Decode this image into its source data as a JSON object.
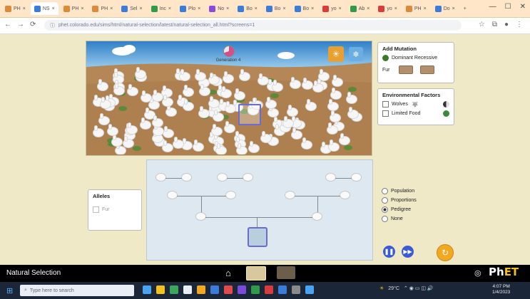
{
  "browser": {
    "tabs": [
      {
        "label": "PH"
      },
      {
        "label": "NS"
      },
      {
        "label": "PH"
      },
      {
        "label": "PH"
      },
      {
        "label": "Sel"
      },
      {
        "label": "Inc"
      },
      {
        "label": "Plo"
      },
      {
        "label": "No"
      },
      {
        "label": "Bo"
      },
      {
        "label": "Bo"
      },
      {
        "label": "Bo"
      },
      {
        "label": "yo"
      },
      {
        "label": "Ab"
      },
      {
        "label": "yo"
      },
      {
        "label": "PH"
      },
      {
        "label": "Do"
      }
    ],
    "new_tab": "+",
    "url": "phet.colorado.edu/sims/html/natural-selection/latest/natural-selection_all.html?screens=1"
  },
  "sim": {
    "generation_label": "Generation 4",
    "add_mutation": {
      "title": "Add Mutation",
      "dominant_recessive": "Dominant Recessive",
      "fur_label": "Fur"
    },
    "environmental_factors": {
      "title": "Environmental Factors",
      "items": [
        {
          "label": "Wolves"
        },
        {
          "label": "Limited Food"
        }
      ]
    },
    "alleles": {
      "title": "Alleles",
      "items": [
        {
          "label": "Fur"
        }
      ]
    },
    "views": [
      {
        "label": "Population",
        "selected": false
      },
      {
        "label": "Proportions",
        "selected": false
      },
      {
        "label": "Pedigree",
        "selected": true
      },
      {
        "label": "None",
        "selected": false
      }
    ]
  },
  "navbar": {
    "title": "Natural Selection",
    "brand": "PhET",
    "brand_prefix": "Ph",
    "brand_suffix": "ET"
  },
  "taskbar": {
    "search_placeholder": "Type here to search",
    "weather": "29°C",
    "time": "4:07 PM",
    "date": "1/4/2023"
  }
}
